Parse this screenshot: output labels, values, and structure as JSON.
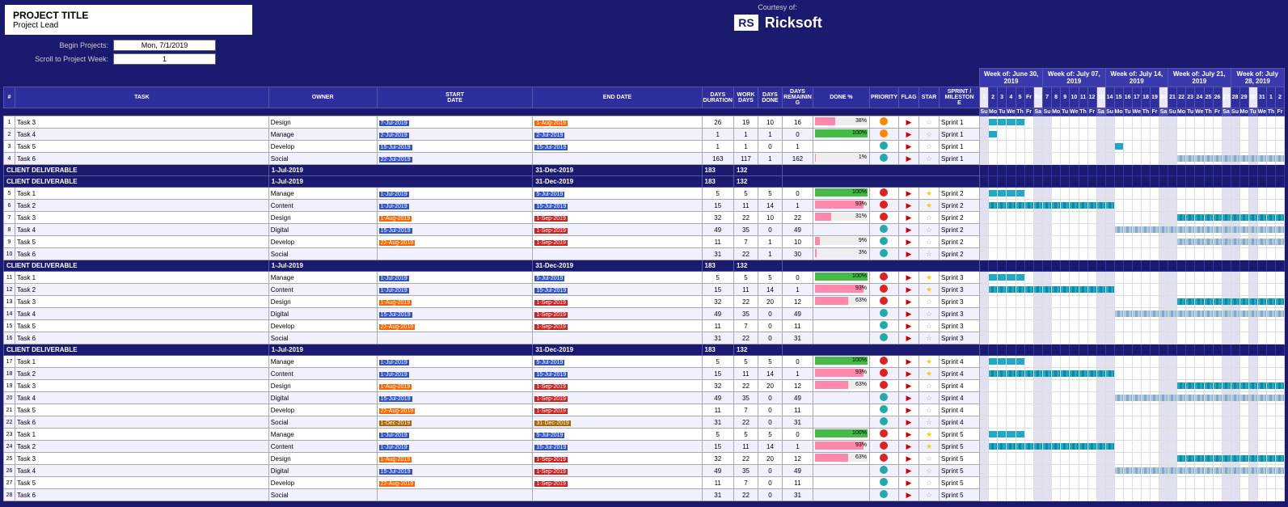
{
  "header": {
    "project_title": "PROJECT TITLE",
    "project_lead": "Project Lead",
    "courtesy_text": "Courtesy of:",
    "rs_label": "RS",
    "brand_name": "Ricksoft",
    "begin_label": "Begin Projects:",
    "begin_value": "Mon, 7/1/2019",
    "scroll_label": "Scroll to Project Week:",
    "scroll_value": "1"
  },
  "weeks": [
    "Week of: June 30, 2019",
    "Week of: July 07, 2019",
    "Week of: July 14, 2019",
    "Week of: July 21, 2019",
    "Week of: July 28, 2019"
  ],
  "columns": {
    "row_num": "#",
    "task": "TASK",
    "owner": "OWNER",
    "start_date": "START DATE",
    "end_date": "END DATE",
    "days_duration": "DAYS DURATION",
    "work_days": "WORK DAYS",
    "days_done": "DAYS DONE",
    "days_remaining": "DAYS REMAINING",
    "done_pct": "DONE %",
    "priority": "PRIORITY",
    "flag": "FLAG",
    "star": "STAR",
    "sprint": "SPRINT / MILESTONE"
  },
  "groups": [
    {
      "id": "g0",
      "tasks": [
        {
          "id": "t3",
          "name": "Task 3",
          "owner": "Design",
          "start": "7-Jul-2019",
          "end": "1-Aug-2019",
          "duration": 26,
          "work": 19,
          "done": 10,
          "remaining": 16,
          "pct": 38,
          "priority": "orange",
          "flag": true,
          "star": false,
          "sprint": "Sprint 1",
          "status": "empty"
        },
        {
          "id": "t4",
          "name": "Task 4",
          "owner": "Manage",
          "start": "2-Jul-2019",
          "end": "2-Jul-2019",
          "duration": 1,
          "work": 1,
          "done": 1,
          "remaining": 0,
          "pct": 100,
          "priority": "orange",
          "flag": true,
          "star": false,
          "sprint": "Sprint 1",
          "status": "empty"
        },
        {
          "id": "t5",
          "name": "Task 5",
          "owner": "Develop",
          "start": "15-Jul-2019",
          "end": "15-Jul-2019",
          "duration": 1,
          "work": 1,
          "done": 0,
          "remaining": 1,
          "pct": 0,
          "priority": "teal",
          "flag": true,
          "star": false,
          "sprint": "Sprint 1",
          "status": "empty"
        },
        {
          "id": "t6",
          "name": "Task 6",
          "owner": "Social",
          "start": "22-Jul-2019",
          "end": "",
          "duration": 163,
          "work": 117,
          "done": 1,
          "remaining": 162,
          "pct": 1,
          "priority": "teal",
          "flag": true,
          "star": false,
          "sprint": "Sprint 1",
          "status": "empty"
        }
      ],
      "deliverable": {
        "label": "CLIENT DELIVERABLE",
        "start": "1-Jul-2019",
        "end": "31-Dec-2019",
        "d183": 183,
        "d132": 132
      }
    },
    {
      "id": "g1",
      "tasks": [
        {
          "id": "t1",
          "name": "Task 1",
          "owner": "Manage",
          "start": "1-Jul-2019",
          "end": "5-Jul-2019",
          "duration": 5,
          "work": 5,
          "done": 5,
          "remaining": 0,
          "pct": 100,
          "priority": "red",
          "flag": true,
          "star": true,
          "sprint": "Sprint 2",
          "status": "green"
        },
        {
          "id": "t2",
          "name": "Task 2",
          "owner": "Content",
          "start": "1-Jul-2019",
          "end": "15-Jul-2019",
          "duration": 15,
          "work": 11,
          "done": 14,
          "remaining": 1,
          "pct": 93,
          "priority": "red",
          "flag": true,
          "star": true,
          "sprint": "Sprint 2",
          "status": "empty"
        },
        {
          "id": "t3",
          "name": "Task 3",
          "owner": "Design",
          "start": "1-Aug-2019",
          "end": "1-Sep-2019",
          "duration": 32,
          "work": 22,
          "done": 10,
          "remaining": 22,
          "pct": 31,
          "priority": "red",
          "flag": true,
          "star": false,
          "sprint": "Sprint 2",
          "status": "empty"
        },
        {
          "id": "t4",
          "name": "Task 4",
          "owner": "Digital",
          "start": "15-Jul-2019",
          "end": "1-Sep-2019",
          "duration": 49,
          "work": 35,
          "done": 0,
          "remaining": 49,
          "pct": 0,
          "priority": "teal",
          "flag": true,
          "star": false,
          "sprint": "Sprint 2",
          "status": "empty"
        },
        {
          "id": "t5",
          "name": "Task 5",
          "owner": "Develop",
          "start": "22-Aug-2019",
          "end": "1-Sep-2019",
          "duration": 11,
          "work": 7,
          "done": 1,
          "remaining": 10,
          "pct": 9,
          "priority": "teal",
          "flag": true,
          "star": false,
          "sprint": "Sprint 2",
          "status": "empty"
        },
        {
          "id": "t6",
          "name": "Task 6",
          "owner": "Social",
          "start": "",
          "end": "",
          "duration": 31,
          "work": 22,
          "done": 1,
          "remaining": 30,
          "pct": 3,
          "priority": "teal",
          "flag": true,
          "star": false,
          "sprint": "Sprint 2",
          "status": "empty"
        }
      ],
      "deliverable": {
        "label": "CLIENT DELIVERABLE",
        "start": "1-Jul-2019",
        "end": "31-Dec-2019",
        "d183": 183,
        "d132": 132
      }
    },
    {
      "id": "g2",
      "tasks": [
        {
          "id": "t1",
          "name": "Task 1",
          "owner": "Manage",
          "start": "1-Jul-2019",
          "end": "5-Jul-2019",
          "duration": 5,
          "work": 5,
          "done": 5,
          "remaining": 0,
          "pct": 100,
          "priority": "red",
          "flag": true,
          "star": true,
          "sprint": "Sprint 3",
          "status": "green"
        },
        {
          "id": "t2",
          "name": "Task 2",
          "owner": "Content",
          "start": "1-Jul-2019",
          "end": "15-Jul-2019",
          "duration": 15,
          "work": 11,
          "done": 14,
          "remaining": 1,
          "pct": 93,
          "priority": "red",
          "flag": true,
          "star": true,
          "sprint": "Sprint 3",
          "status": "empty"
        },
        {
          "id": "t3",
          "name": "Task 3",
          "owner": "Design",
          "start": "1-Aug-2019",
          "end": "1-Sep-2019",
          "duration": 32,
          "work": 22,
          "done": 20,
          "remaining": 12,
          "pct": 63,
          "priority": "red",
          "flag": true,
          "star": false,
          "sprint": "Sprint 3",
          "status": "empty"
        },
        {
          "id": "t4",
          "name": "Task 4",
          "owner": "Digital",
          "start": "15-Jul-2019",
          "end": "1-Sep-2019",
          "duration": 49,
          "work": 35,
          "done": 0,
          "remaining": 49,
          "pct": 0,
          "priority": "teal",
          "flag": true,
          "star": false,
          "sprint": "Sprint 3",
          "status": "empty"
        },
        {
          "id": "t5",
          "name": "Task 5",
          "owner": "Develop",
          "start": "22-Aug-2019",
          "end": "1-Sep-2019",
          "duration": 11,
          "work": 7,
          "done": 0,
          "remaining": 11,
          "pct": 0,
          "priority": "teal",
          "flag": true,
          "star": false,
          "sprint": "Sprint 3",
          "status": "empty"
        },
        {
          "id": "t6",
          "name": "Task 6",
          "owner": "Social",
          "start": "",
          "end": "",
          "duration": 31,
          "work": 22,
          "done": 0,
          "remaining": 31,
          "pct": 0,
          "priority": "teal",
          "flag": true,
          "star": false,
          "sprint": "Sprint 3",
          "status": "empty"
        }
      ],
      "deliverable": {
        "label": "CLIENT DELIVERABLE",
        "start": "1-Jul-2019",
        "end": "31-Dec-2019",
        "d183": 183,
        "d132": 132
      }
    },
    {
      "id": "g3",
      "tasks": [
        {
          "id": "t1",
          "name": "Task 1",
          "owner": "Manage",
          "start": "1-Jul-2019",
          "end": "5-Jul-2019",
          "duration": 5,
          "work": 5,
          "done": 5,
          "remaining": 0,
          "pct": 100,
          "priority": "red",
          "flag": true,
          "star": true,
          "sprint": "Sprint 4",
          "status": "green"
        },
        {
          "id": "t2",
          "name": "Task 2",
          "owner": "Content",
          "start": "1-Jul-2019",
          "end": "15-Jul-2019",
          "duration": 15,
          "work": 11,
          "done": 14,
          "remaining": 1,
          "pct": 93,
          "priority": "red",
          "flag": true,
          "star": true,
          "sprint": "Sprint 4",
          "status": "empty"
        },
        {
          "id": "t3",
          "name": "Task 3",
          "owner": "Design",
          "start": "1-Aug-2019",
          "end": "1-Sep-2019",
          "duration": 32,
          "work": 22,
          "done": 20,
          "remaining": 12,
          "pct": 63,
          "priority": "red",
          "flag": true,
          "star": false,
          "sprint": "Sprint 4",
          "status": "empty"
        },
        {
          "id": "t4",
          "name": "Task 4",
          "owner": "Digital",
          "start": "15-Jul-2019",
          "end": "1-Sep-2019",
          "duration": 49,
          "work": 35,
          "done": 0,
          "remaining": 49,
          "pct": 0,
          "priority": "teal",
          "flag": true,
          "star": false,
          "sprint": "Sprint 4",
          "status": "empty"
        },
        {
          "id": "t5",
          "name": "Task 5",
          "owner": "Develop",
          "start": "22-Aug-2019",
          "end": "1-Sep-2019",
          "duration": 11,
          "work": 7,
          "done": 0,
          "remaining": 11,
          "pct": 0,
          "priority": "teal",
          "flag": true,
          "star": false,
          "sprint": "Sprint 4",
          "status": "empty"
        },
        {
          "id": "t6",
          "name": "Task 6",
          "owner": "Social",
          "start": "1-Dec-2019",
          "end": "31-Dec-2019",
          "duration": 31,
          "work": 22,
          "done": 0,
          "remaining": 31,
          "pct": 0,
          "priority": "teal",
          "flag": true,
          "star": false,
          "sprint": "Sprint 4",
          "status": "empty"
        }
      ],
      "deliverable": {
        "label": "CLIENT DELIVERABLE",
        "start": "1-Jul-2019",
        "end": "31-Dec-2019",
        "d183": 183,
        "d132": 132
      }
    },
    {
      "id": "g4",
      "tasks": [
        {
          "id": "t1",
          "name": "Task 1",
          "owner": "Manage",
          "start": "1-Jul-2019",
          "end": "5-Jul-2019",
          "duration": 5,
          "work": 5,
          "done": 5,
          "remaining": 0,
          "pct": 100,
          "priority": "red",
          "flag": true,
          "star": true,
          "sprint": "Sprint 5",
          "status": "green"
        },
        {
          "id": "t2",
          "name": "Task 2",
          "owner": "Content",
          "start": "1-Jul-2019",
          "end": "15-Jul-2019",
          "duration": 15,
          "work": 11,
          "done": 14,
          "remaining": 1,
          "pct": 93,
          "priority": "red",
          "flag": true,
          "star": true,
          "sprint": "Sprint 5",
          "status": "empty"
        },
        {
          "id": "t3",
          "name": "Task 3",
          "owner": "Design",
          "start": "1-Aug-2019",
          "end": "1-Sep-2019",
          "duration": 32,
          "work": 22,
          "done": 20,
          "remaining": 12,
          "pct": 63,
          "priority": "red",
          "flag": true,
          "star": false,
          "sprint": "Sprint 5",
          "status": "empty"
        },
        {
          "id": "t4",
          "name": "Task 4",
          "owner": "Digital",
          "start": "15-Jul-2019",
          "end": "1-Sep-2019",
          "duration": 49,
          "work": 35,
          "done": 0,
          "remaining": 49,
          "pct": 0,
          "priority": "teal",
          "flag": true,
          "star": false,
          "sprint": "Sprint 5",
          "status": "empty"
        },
        {
          "id": "t5",
          "name": "Task 5",
          "owner": "Develop",
          "start": "22-Aug-2019",
          "end": "1-Sep-2019",
          "duration": 11,
          "work": 7,
          "done": 0,
          "remaining": 11,
          "pct": 0,
          "priority": "teal",
          "flag": true,
          "star": false,
          "sprint": "Sprint 5",
          "status": "empty"
        },
        {
          "id": "t6",
          "name": "Task 6",
          "owner": "Social",
          "start": "",
          "end": "",
          "duration": 31,
          "work": 22,
          "done": 0,
          "remaining": 31,
          "pct": 0,
          "priority": "teal",
          "flag": true,
          "star": false,
          "sprint": "Sprint 5",
          "status": "empty"
        }
      ],
      "deliverable": null
    }
  ]
}
